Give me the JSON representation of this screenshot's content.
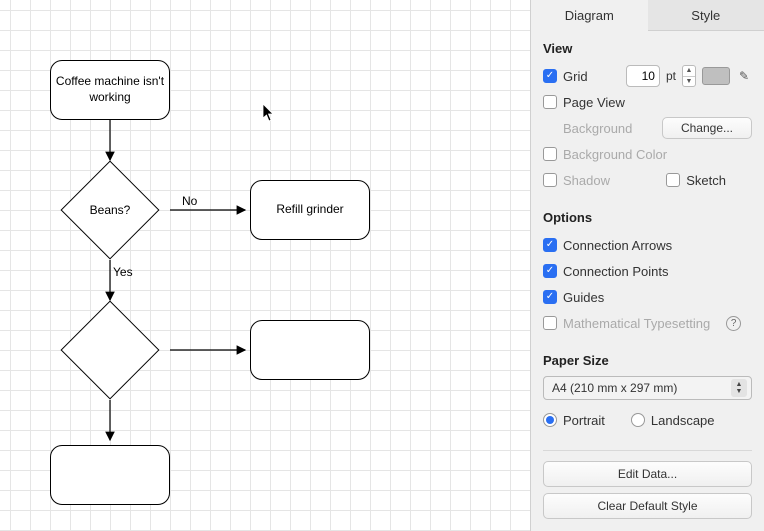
{
  "canvas": {
    "nodes": {
      "start": "Coffee machine isn't working",
      "decision1": "Beans?",
      "action1": "Refill grinder",
      "decision2": "",
      "action2": "",
      "end": ""
    },
    "edges": {
      "d1_no": "No",
      "d1_yes": "Yes"
    }
  },
  "tabs": {
    "diagram": "Diagram",
    "style": "Style"
  },
  "view": {
    "title": "View",
    "grid": "Grid",
    "grid_value": "10",
    "grid_unit": "pt",
    "page_view": "Page View",
    "background": "Background",
    "change_btn": "Change...",
    "background_color": "Background Color",
    "shadow": "Shadow",
    "sketch": "Sketch"
  },
  "options": {
    "title": "Options",
    "connection_arrows": "Connection Arrows",
    "connection_points": "Connection Points",
    "guides": "Guides",
    "math": "Mathematical Typesetting"
  },
  "paper": {
    "title": "Paper Size",
    "selected": "A4 (210 mm x 297 mm)",
    "portrait": "Portrait",
    "landscape": "Landscape"
  },
  "buttons": {
    "edit_data": "Edit Data...",
    "clear_style": "Clear Default Style"
  }
}
